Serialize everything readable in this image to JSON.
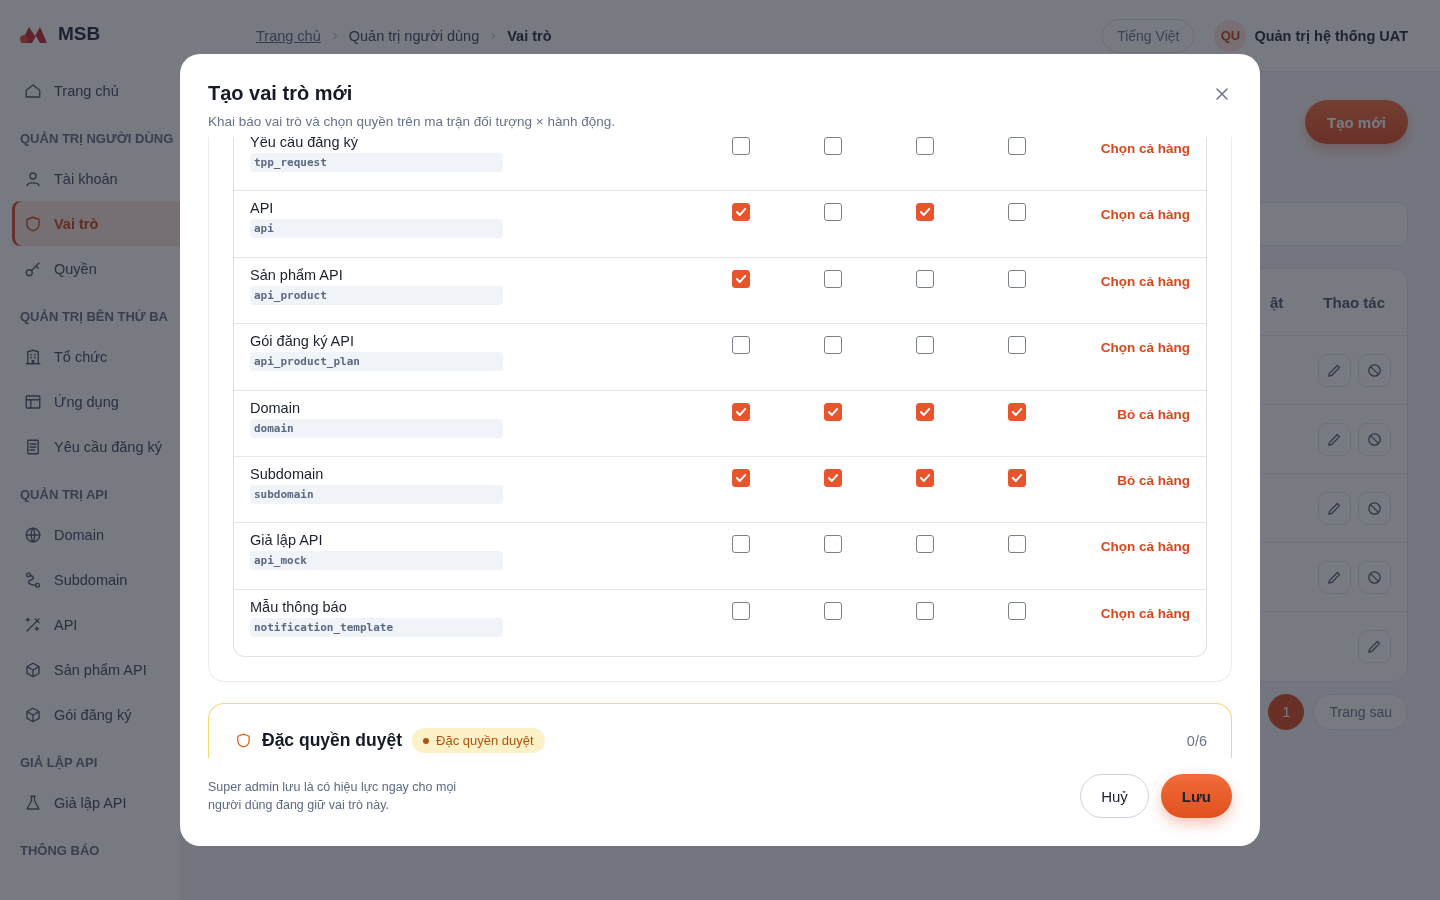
{
  "sidebar": {
    "logo": "MSB",
    "items": [
      {
        "kind": "link",
        "label": "Trang chủ",
        "selected": false
      },
      {
        "kind": "section",
        "label": "QUẢN TRỊ NGƯỜI DÙNG"
      },
      {
        "kind": "link",
        "label": "Tài khoản",
        "selected": false
      },
      {
        "kind": "link",
        "label": "Vai trò",
        "selected": true
      },
      {
        "kind": "link",
        "label": "Quyền",
        "selected": false
      },
      {
        "kind": "section",
        "label": "QUẢN TRỊ BÊN THỨ BA"
      },
      {
        "kind": "link",
        "label": "Tổ chức",
        "selected": false
      },
      {
        "kind": "link",
        "label": "Ứng dụng",
        "selected": false
      },
      {
        "kind": "link",
        "label": "Yêu cầu đăng ký",
        "selected": false
      },
      {
        "kind": "section",
        "label": "QUẢN TRỊ API"
      },
      {
        "kind": "link",
        "label": "Domain",
        "selected": false
      },
      {
        "kind": "link",
        "label": "Subdomain",
        "selected": false
      },
      {
        "kind": "link",
        "label": "API",
        "selected": false
      },
      {
        "kind": "link",
        "label": "Sản phẩm API",
        "selected": false
      },
      {
        "kind": "link",
        "label": "Gói đăng ký",
        "selected": false
      },
      {
        "kind": "section",
        "label": "GIẢ LẬP API"
      },
      {
        "kind": "link",
        "label": "Giả lập API",
        "selected": false
      },
      {
        "kind": "section",
        "label": "THÔNG BÁO"
      }
    ]
  },
  "header": {
    "breadcrumbs": [
      {
        "label": "Trang chủ",
        "kind": "link"
      },
      {
        "label": "Quản trị người dùng",
        "kind": "plain"
      },
      {
        "label": "Vai trò",
        "kind": "current"
      }
    ],
    "language": "Tiếng Việt",
    "avatar": "QU",
    "user": "Quản trị hệ thống UAT"
  },
  "page": {
    "create_button": "Tạo mới",
    "table": {
      "columns": [
        "ật",
        "Thao tác"
      ],
      "rows": [
        {
          "kind": "edit_block"
        },
        {
          "kind": "edit_block"
        },
        {
          "kind": "edit_block"
        },
        {
          "kind": "edit_block"
        },
        {
          "kind": "edit_only"
        }
      ]
    },
    "pagination": {
      "pages": [
        {
          "label": "1",
          "selected": true
        }
      ],
      "next": "Trang sau"
    }
  },
  "modal": {
    "title": "Tạo vai trò mới",
    "subtitle": "Khai báo vai trò và chọn quyền trên ma trận đối tượng × hành động.",
    "rows": [
      {
        "name": "Yêu cầu đăng ký",
        "code": "tpp_request",
        "checks": [
          false,
          false,
          false,
          false
        ],
        "action": "Chọn cả hàng"
      },
      {
        "name": "API",
        "code": "api",
        "checks": [
          true,
          false,
          true,
          false
        ],
        "action": "Chọn cả hàng"
      },
      {
        "name": "Sản phẩm API",
        "code": "api_product",
        "checks": [
          true,
          false,
          false,
          false
        ],
        "action": "Chọn cả hàng"
      },
      {
        "name": "Gói đăng ký API",
        "code": "api_product_plan",
        "checks": [
          false,
          false,
          false,
          false
        ],
        "action": "Chọn cả hàng"
      },
      {
        "name": "Domain",
        "code": "domain",
        "checks": [
          true,
          true,
          true,
          true
        ],
        "action": "Bỏ cả hàng"
      },
      {
        "name": "Subdomain",
        "code": "subdomain",
        "checks": [
          true,
          true,
          true,
          true
        ],
        "action": "Bỏ cả hàng"
      },
      {
        "name": "Giả lập API",
        "code": "api_mock",
        "checks": [
          false,
          false,
          false,
          false
        ],
        "action": "Chọn cả hàng"
      },
      {
        "name": "Mẫu thông báo",
        "code": "notification_template",
        "checks": [
          false,
          false,
          false,
          false
        ],
        "action": "Chọn cả hàng"
      }
    ],
    "section": {
      "title": "Đặc quyền duyệt",
      "badge": "Đặc quyền duyệt",
      "count": "0/6"
    },
    "note": "Super admin lưu là có hiệu lực ngay cho mọi người dùng đang giữ vai trò này.",
    "buttons": [
      {
        "label": "Huỷ",
        "kind": "secondary"
      },
      {
        "label": "Lưu",
        "kind": "primary"
      }
    ]
  }
}
